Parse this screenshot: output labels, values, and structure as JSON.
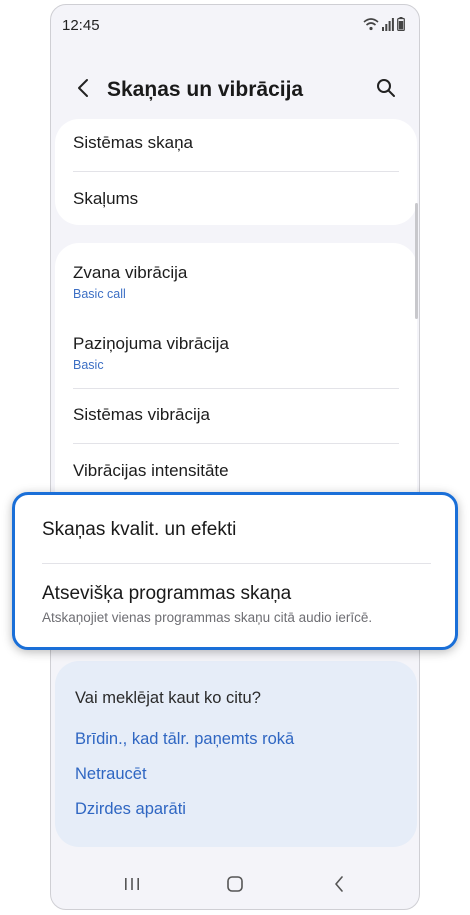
{
  "status_bar": {
    "time": "12:45"
  },
  "header": {
    "title": "Skaņas un vibrācija"
  },
  "sound_group": {
    "items": [
      {
        "label": "Sistēmas skaņa"
      },
      {
        "label": "Skaļums"
      }
    ]
  },
  "vibration_group": {
    "items": [
      {
        "label": "Zvana vibrācija",
        "sublabel": "Basic call"
      },
      {
        "label": "Paziņojuma vibrācija",
        "sublabel": "Basic"
      },
      {
        "label": "Sistēmas vibrācija"
      },
      {
        "label": "Vibrācijas intensitāte"
      }
    ]
  },
  "highlighted": {
    "items": [
      {
        "label": "Skaņas kvalit. un efekti"
      },
      {
        "label": "Atsevišķa programmas skaņa",
        "description": "Atskaņojiet vienas programmas skaņu citā audio ierīcē."
      }
    ]
  },
  "suggestions": {
    "heading": "Vai meklējat kaut ko citu?",
    "links": [
      {
        "label": "Brīdin., kad tālr. paņemts rokā"
      },
      {
        "label": "Netraucēt"
      },
      {
        "label": "Dzirdes aparāti"
      }
    ]
  },
  "colors": {
    "accent": "#1a6fd8",
    "link": "#2f66c2",
    "background": "#f4f4f9",
    "suggestion_card": "#e6edf8"
  },
  "icons": {
    "back": "chevron-left-icon",
    "search": "search-icon",
    "wifi": "wifi-icon",
    "signal": "signal-icon",
    "battery": "battery-icon",
    "recents": "recents-icon",
    "home": "home-icon",
    "nav_back": "nav-back-icon"
  }
}
